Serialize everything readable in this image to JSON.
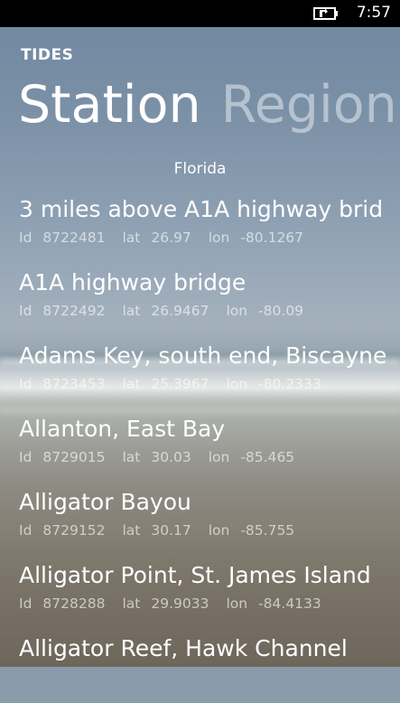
{
  "status_bar": {
    "time": "7:57",
    "battery_icon": "battery-charging-icon"
  },
  "app": {
    "title": "TIDES"
  },
  "pivot": {
    "active": "Station",
    "inactive": "Region"
  },
  "section_header": "Florida",
  "labels": {
    "id": "Id",
    "lat": "lat",
    "lon": "lon"
  },
  "stations": [
    {
      "name": "3 miles above A1A highway brid",
      "id": "8722481",
      "lat": "26.97",
      "lon": "-80.1267"
    },
    {
      "name": "A1A highway bridge",
      "id": "8722492",
      "lat": "26.9467",
      "lon": "-80.09"
    },
    {
      "name": "Adams Key, south end, Biscayne",
      "id": "8723453",
      "lat": "25.3967",
      "lon": "-80.2333"
    },
    {
      "name": "Allanton, East Bay",
      "id": "8729015",
      "lat": "30.03",
      "lon": "-85.465"
    },
    {
      "name": "Alligator Bayou",
      "id": "8729152",
      "lat": "30.17",
      "lon": "-85.755"
    },
    {
      "name": "Alligator Point, St. James Island",
      "id": "8728288",
      "lat": "29.9033",
      "lon": "-84.4133"
    },
    {
      "name": "Alligator Reef, Hawk Channel",
      "id": "",
      "lat": "",
      "lon": ""
    }
  ]
}
